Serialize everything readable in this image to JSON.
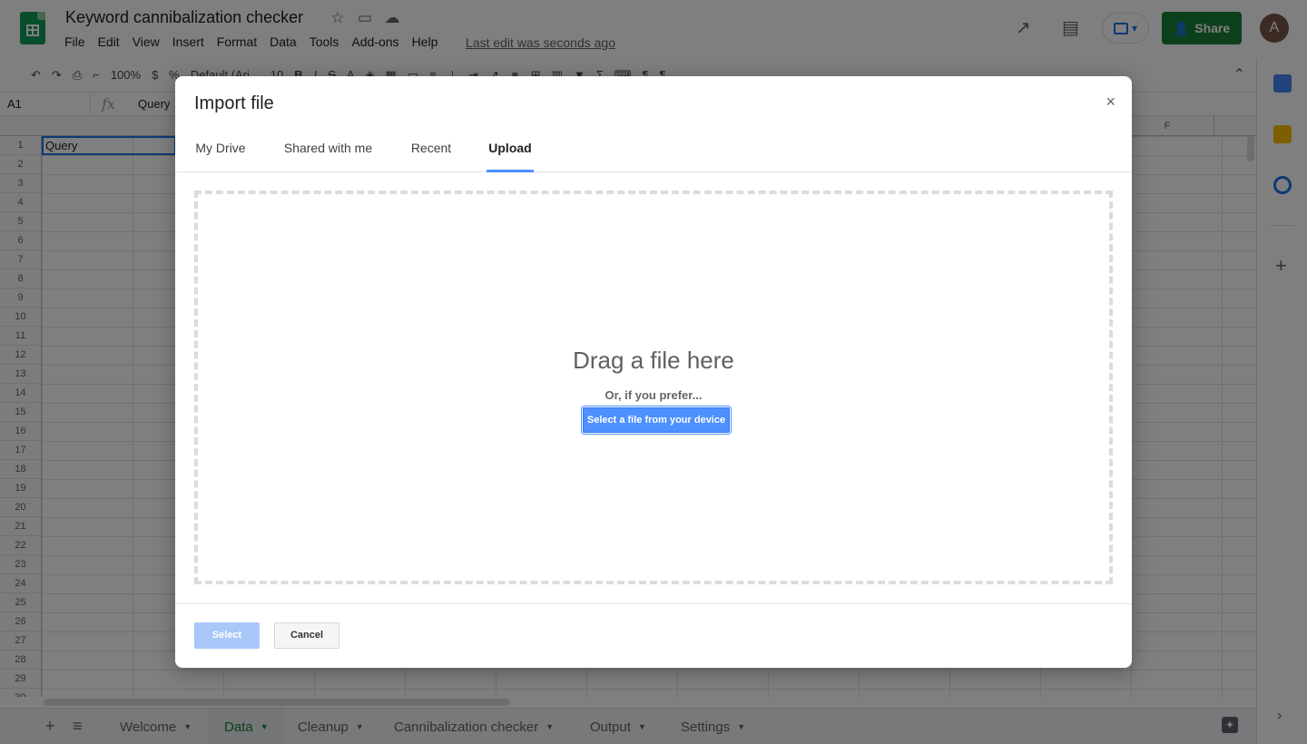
{
  "app": {
    "title": "Keyword cannibalization checker",
    "last_edit": "Last edit was seconds ago",
    "menu": [
      "File",
      "Edit",
      "View",
      "Insert",
      "Format",
      "Data",
      "Tools",
      "Add-ons",
      "Help"
    ],
    "share_label": "Share",
    "avatar_initial": "A"
  },
  "toolbar": {
    "zoom": "100%",
    "font": "Default (Ari...",
    "font_size": "10"
  },
  "formula_bar": {
    "cell_ref": "A1",
    "fx": "fx",
    "content": "Query"
  },
  "grid": {
    "a1_value": "Query",
    "last_col_label": "F",
    "row_numbers": [
      "1",
      "2",
      "3",
      "4",
      "5",
      "6",
      "7",
      "8",
      "9",
      "10",
      "11",
      "12",
      "13",
      "14",
      "15",
      "16",
      "17",
      "18",
      "19",
      "20",
      "21",
      "22",
      "23",
      "24",
      "25",
      "26",
      "27",
      "28",
      "29",
      "30"
    ]
  },
  "sheet_tabs": [
    {
      "label": "Welcome",
      "active": false
    },
    {
      "label": "Data",
      "active": true
    },
    {
      "label": "Cleanup",
      "active": false
    },
    {
      "label": "Cannibalization checker",
      "active": false
    },
    {
      "label": "Output",
      "active": false
    },
    {
      "label": "Settings",
      "active": false
    }
  ],
  "dialog": {
    "title": "Import file",
    "close": "×",
    "tabs": [
      "My Drive",
      "Shared with me",
      "Recent",
      "Upload"
    ],
    "active_tab": "Upload",
    "drag_text": "Drag a file here",
    "or_text": "Or, if you prefer...",
    "select_device_label": "Select a file from your device",
    "select_label": "Select",
    "cancel_label": "Cancel"
  },
  "colors": {
    "brand_green": "#0f9d58",
    "share_green": "#188038",
    "dialog_blue": "#4d90fe",
    "select_disabled": "#a9c7f8"
  },
  "icons": [
    "sheets-logo-icon",
    "star-icon",
    "move-folder-icon",
    "cloud-status-icon",
    "trending-icon",
    "comments-icon",
    "present-icon",
    "person-add-icon",
    "calendar-icon",
    "keep-icon",
    "tasks-icon",
    "plus-icon",
    "chevron-right-icon"
  ]
}
